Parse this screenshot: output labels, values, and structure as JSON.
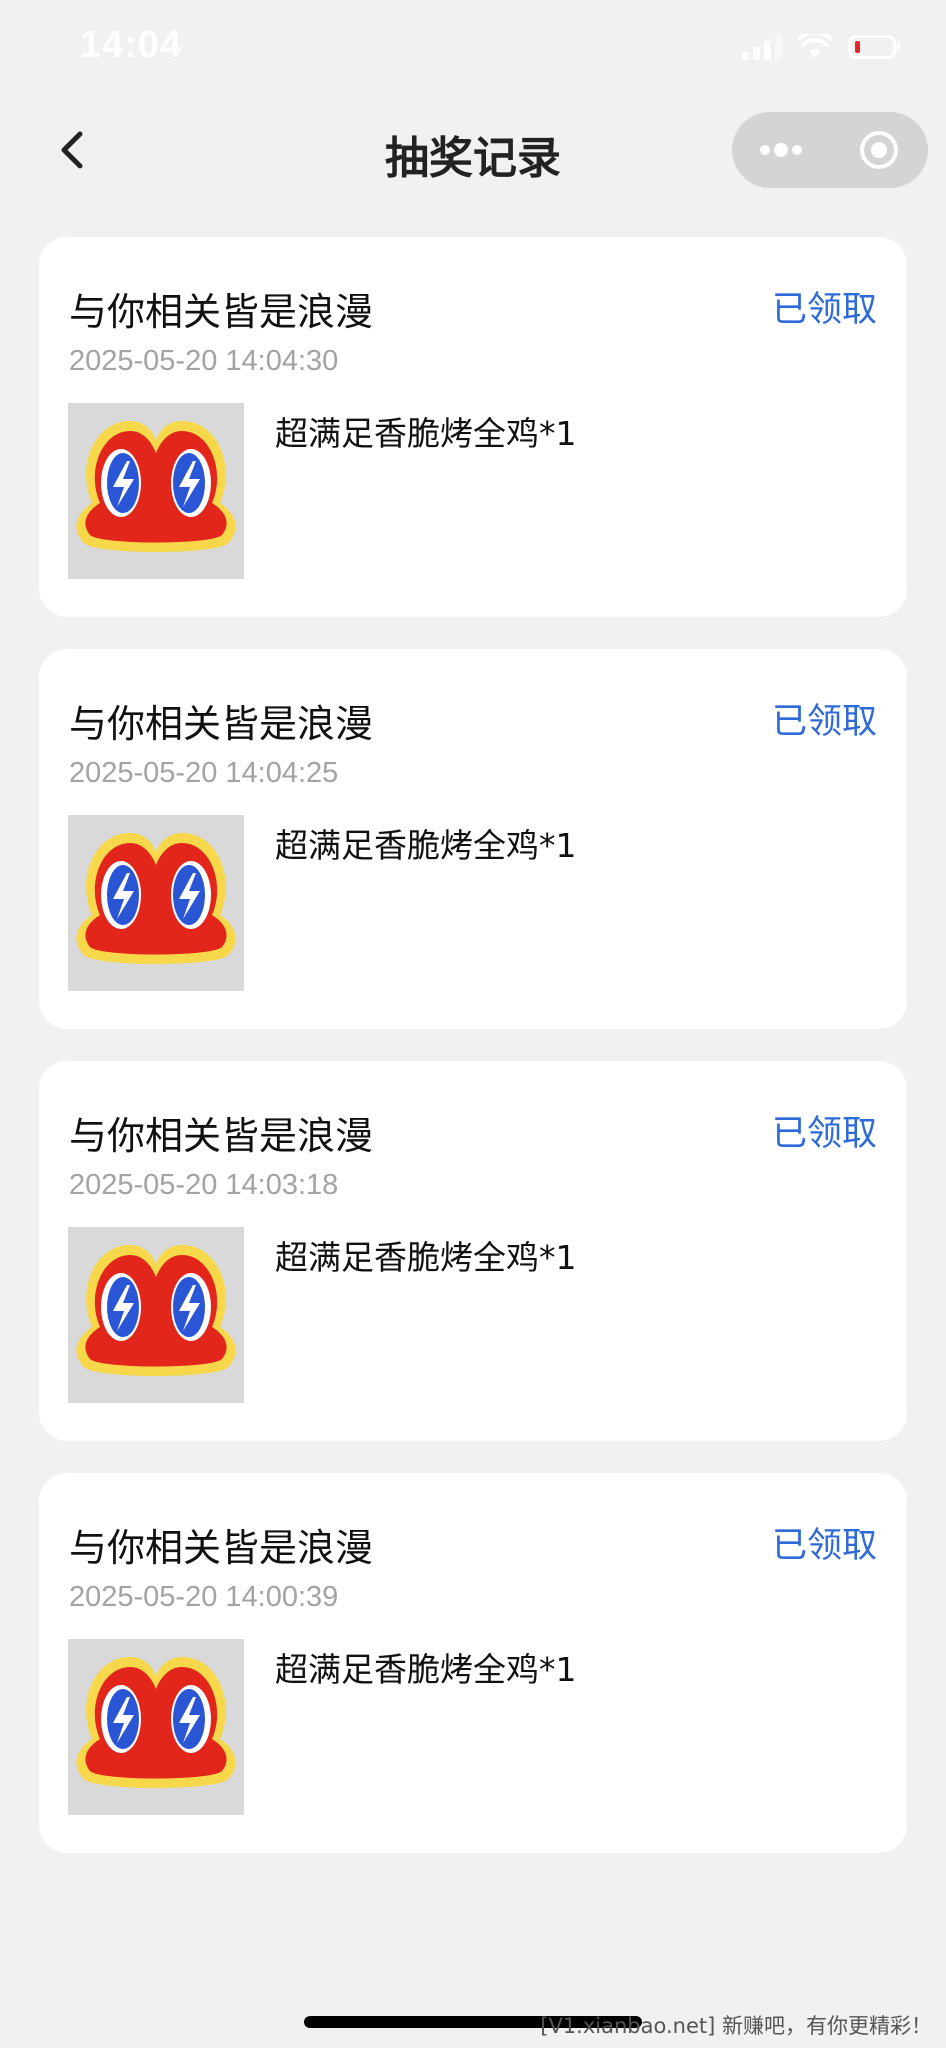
{
  "status_bar": {
    "time": "14:04"
  },
  "nav": {
    "title": "抽奖记录",
    "back_icon": "chevron-left-icon",
    "more_icon": "more-dots-icon",
    "close_icon": "target-circle-icon"
  },
  "records": [
    {
      "name": "与你相关皆是浪漫",
      "status": "已领取",
      "time": "2025-05-20 14:04:30",
      "prize": "超满足香脆烤全鸡*1"
    },
    {
      "name": "与你相关皆是浪漫",
      "status": "已领取",
      "time": "2025-05-20 14:04:25",
      "prize": "超满足香脆烤全鸡*1"
    },
    {
      "name": "与你相关皆是浪漫",
      "status": "已领取",
      "time": "2025-05-20 14:03:18",
      "prize": "超满足香脆烤全鸡*1"
    },
    {
      "name": "与你相关皆是浪漫",
      "status": "已领取",
      "time": "2025-05-20 14:00:39",
      "prize": "超满足香脆烤全鸡*1"
    }
  ],
  "colors": {
    "background": "#f1f1f1",
    "card": "#ffffff",
    "status_blue": "#2f6ad9",
    "time_gray": "#a3a3a3",
    "logo_red": "#e3261c",
    "logo_yellow": "#f7d84a",
    "logo_blue": "#2a56d6"
  },
  "watermark": "[V1.xianbao.net] 新赚吧，有你更精彩！"
}
